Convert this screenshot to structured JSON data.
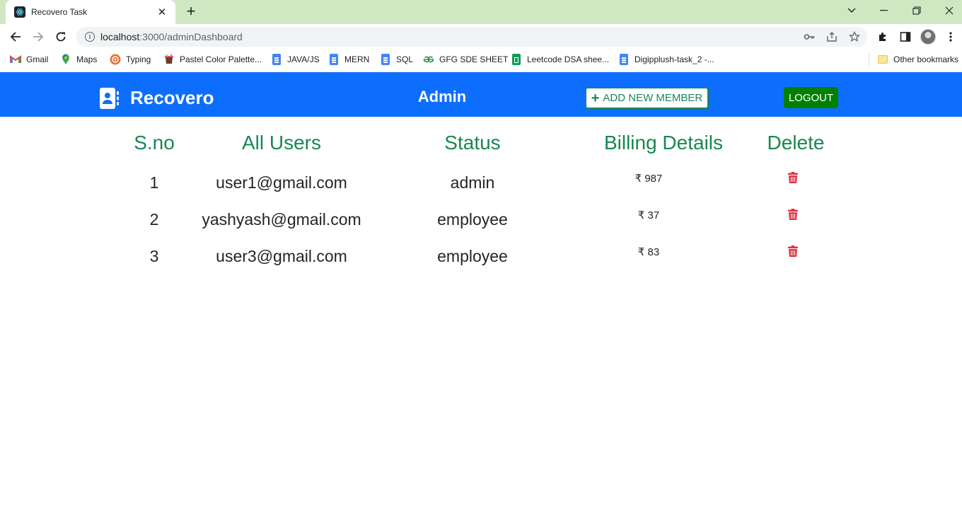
{
  "browser": {
    "tab_title": "Recovero Task",
    "url_host": "localhost",
    "url_rest": ":3000/adminDashboard",
    "bookmarks": [
      {
        "label": "Gmail",
        "icon": "gmail-icon"
      },
      {
        "label": "Maps",
        "icon": "maps-icon"
      },
      {
        "label": "Typing",
        "icon": "typing-icon"
      },
      {
        "label": "Pastel Color Palette...",
        "icon": "palette-icon"
      },
      {
        "label": "JAVA/JS",
        "icon": "docs-icon"
      },
      {
        "label": "MERN",
        "icon": "docs-icon"
      },
      {
        "label": "SQL",
        "icon": "docs-icon"
      },
      {
        "label": "GFG SDE SHEET",
        "icon": "gfg-icon"
      },
      {
        "label": "Leetcode DSA shee...",
        "icon": "sheets-icon"
      },
      {
        "label": "Digipplush-task_2 -...",
        "icon": "docs-icon"
      }
    ],
    "other_bookmarks": "Other bookmarks"
  },
  "navbar": {
    "brand": "Recovero",
    "title": "Admin",
    "add_member_label": "ADD NEW MEMBER",
    "logout_label": "LOGOUT",
    "color": "#0d6efd"
  },
  "table": {
    "headers": {
      "sno": "S.no",
      "users": "All Users",
      "status": "Status",
      "billing": "Billing Details",
      "delete": "Delete"
    },
    "rows": [
      {
        "sno": "1",
        "email": "user1@gmail.com",
        "status": "admin",
        "billing": "₹ 987"
      },
      {
        "sno": "2",
        "email": "yashyash@gmail.com",
        "status": "employee",
        "billing": "₹ 37"
      },
      {
        "sno": "3",
        "email": "user3@gmail.com",
        "status": "employee",
        "billing": "₹ 83"
      }
    ]
  },
  "colors": {
    "header_text": "#198754",
    "delete_icon": "#dc3545",
    "logout_bg": "#008000"
  }
}
